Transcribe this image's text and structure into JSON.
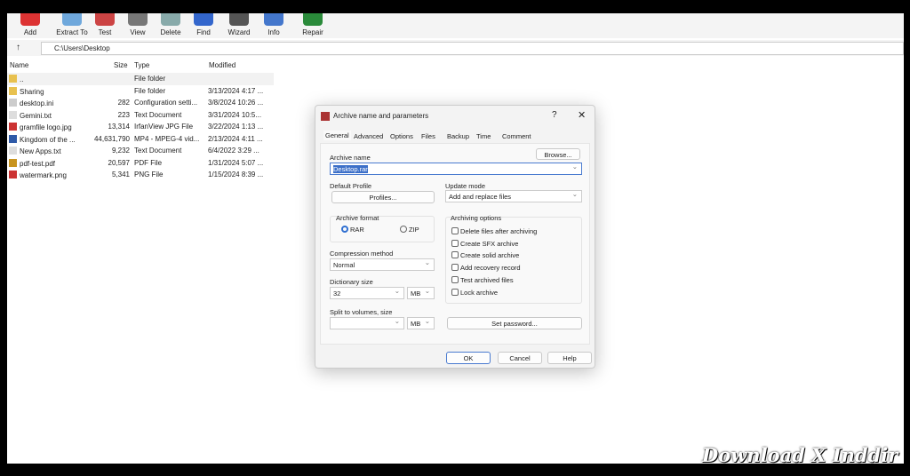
{
  "toolbar": [
    {
      "label": "Add",
      "icon": "add-archive-icon",
      "color": "#d33"
    },
    {
      "label": "Extract To",
      "icon": "extract-icon",
      "color": "#6fa8dc"
    },
    {
      "label": "Test",
      "icon": "test-icon",
      "color": "#c44"
    },
    {
      "label": "View",
      "icon": "view-icon",
      "color": "#777"
    },
    {
      "label": "Delete",
      "icon": "delete-icon",
      "color": "#8aa"
    },
    {
      "label": "Find",
      "icon": "find-icon",
      "color": "#36c"
    },
    {
      "label": "Wizard",
      "icon": "wizard-icon",
      "color": "#555"
    },
    {
      "label": "Info",
      "icon": "info-icon",
      "color": "#47c"
    },
    {
      "label": "Repair",
      "icon": "repair-icon",
      "color": "#2a8a3a"
    }
  ],
  "address": {
    "path": "C:\\Users\\Desktop"
  },
  "columns": {
    "name": "Name",
    "size": "Size",
    "type": "Type",
    "modified": "Modified"
  },
  "files": [
    {
      "name": "..",
      "size": "",
      "type": "File folder",
      "modified": "",
      "icon": "folder-icon"
    },
    {
      "name": "Sharing",
      "size": "",
      "type": "File folder",
      "modified": "3/13/2024 4:17 ...",
      "icon": "folder-icon"
    },
    {
      "name": "desktop.ini",
      "size": "282",
      "type": "Configuration setti...",
      "modified": "3/8/2024 10:26 ...",
      "icon": "settings-file-icon"
    },
    {
      "name": "Gemini.txt",
      "size": "223",
      "type": "Text Document",
      "modified": "3/31/2024 10:5...",
      "icon": "text-file-icon"
    },
    {
      "name": "gramfile logo.jpg",
      "size": "13,314",
      "type": "IrfanView JPG File",
      "modified": "3/22/2024 1:13 ...",
      "icon": "image-file-icon"
    },
    {
      "name": "Kingdom of the ...",
      "size": "44,631,790",
      "type": "MP4 - MPEG-4 vid...",
      "modified": "2/13/2024 4:11 ...",
      "icon": "video-file-icon"
    },
    {
      "name": "New Apps.txt",
      "size": "9,232",
      "type": "Text Document",
      "modified": "6/4/2022 3:29 ...",
      "icon": "text-file-icon"
    },
    {
      "name": "pdf-test.pdf",
      "size": "20,597",
      "type": "PDF File",
      "modified": "1/31/2024 5:07 ...",
      "icon": "pdf-file-icon"
    },
    {
      "name": "watermark.png",
      "size": "5,341",
      "type": "PNG File",
      "modified": "1/15/2024 8:39 ...",
      "icon": "image-file-icon"
    }
  ],
  "dialog": {
    "title": "Archive name and parameters",
    "help": "?",
    "close": "✕",
    "tabs": [
      "General",
      "Advanced",
      "Options",
      "Files",
      "Backup",
      "Time",
      "Comment"
    ],
    "archive_name_label": "Archive name",
    "browse": "Browse...",
    "archive_name": "Desktop.rar",
    "default_profile_label": "Default Profile",
    "profiles": "Profiles...",
    "update_mode_label": "Update mode",
    "update_mode": "Add and replace files",
    "archive_format_label": "Archive format",
    "rar": "RAR",
    "zip": "ZIP",
    "selected_format": "RAR",
    "compression_label": "Compression method",
    "compression": "Normal",
    "dictionary_label": "Dictionary size",
    "dictionary": "32",
    "dictionary_unit": "MB",
    "split_label": "Split to volumes, size",
    "split": "",
    "split_unit": "MB",
    "options_label": "Archiving options",
    "options": [
      {
        "label": "Delete files after archiving",
        "checked": false
      },
      {
        "label": "Create SFX archive",
        "checked": false
      },
      {
        "label": "Create solid archive",
        "checked": false
      },
      {
        "label": "Add recovery record",
        "checked": false
      },
      {
        "label": "Test archived files",
        "checked": false
      },
      {
        "label": "Lock archive",
        "checked": false
      }
    ],
    "set_password": "Set password...",
    "ok": "OK",
    "cancel": "Cancel",
    "help_btn": "Help"
  },
  "watermark": "Download X Inddir"
}
